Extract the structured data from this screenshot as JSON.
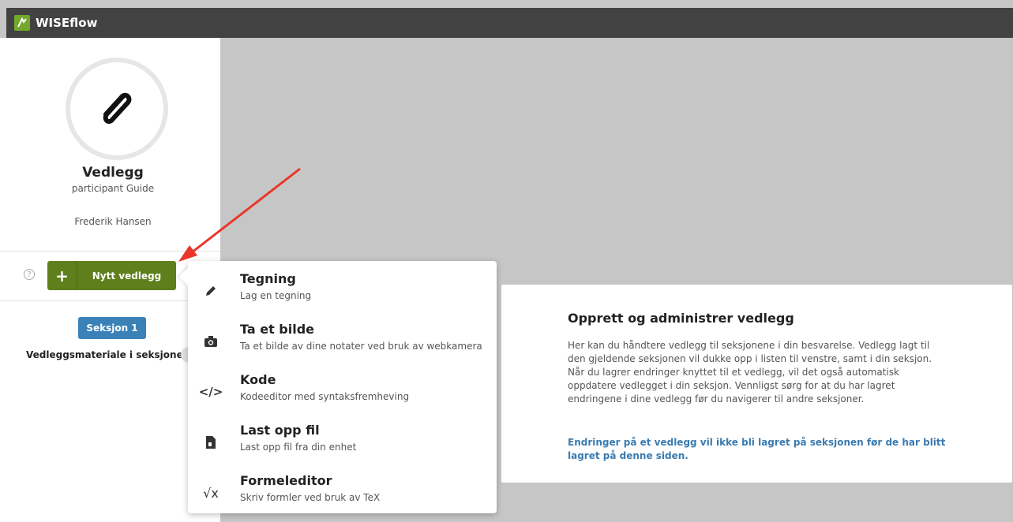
{
  "app": {
    "name": "WISEflow"
  },
  "sidebar": {
    "title": "Vedlegg",
    "subtitle": "participant Guide",
    "user": "Frederik Hansen",
    "help_icon": "?",
    "new_button_plus": "+",
    "new_button_label": "Nytt vedlegg",
    "section_button": "Seksjon 1",
    "section_label": "Vedleggsmateriale i seksjonen"
  },
  "menu": {
    "items": [
      {
        "icon": "pencil-icon",
        "title": "Tegning",
        "desc": "Lag en tegning"
      },
      {
        "icon": "camera-icon",
        "title": "Ta et bilde",
        "desc": "Ta et bilde av dine notater ved bruk av webkamera"
      },
      {
        "icon": "code-icon",
        "title": "Kode",
        "desc": "Kodeeditor med syntaksfremheving",
        "glyph": "</>"
      },
      {
        "icon": "file-upload-icon",
        "title": "Last opp fil",
        "desc": "Last opp fil fra din enhet"
      },
      {
        "icon": "sqrt-icon",
        "title": "Formeleditor",
        "desc": "Skriv formler ved bruk av TeX",
        "glyph": "√x"
      }
    ]
  },
  "info": {
    "title": "Opprett og administrer vedlegg",
    "body": "Her kan du håndtere vedlegg til seksjonene i din besvarelse. Vedlegg lagt til den gjeldende seksjonen vil dukke opp i listen til venstre, samt i din seksjon. Når du lagrer endringer knyttet til et vedlegg, vil det også automatisk oppdatere vedlegget i din seksjon. Vennligst sørg for at du har lagret endringene i dine vedlegg før du navigerer til andre seksjoner.",
    "note": "Endringer på et vedlegg vil ikke bli lagret på seksjonen før de har blitt lagret på denne siden."
  },
  "colors": {
    "topbar": "#424242",
    "brand_green": "#72a82c",
    "button_green": "#5e7f1b",
    "section_blue": "#3a81b8",
    "note_blue": "#3a7bb0",
    "annotation_arrow": "#e8372a"
  }
}
